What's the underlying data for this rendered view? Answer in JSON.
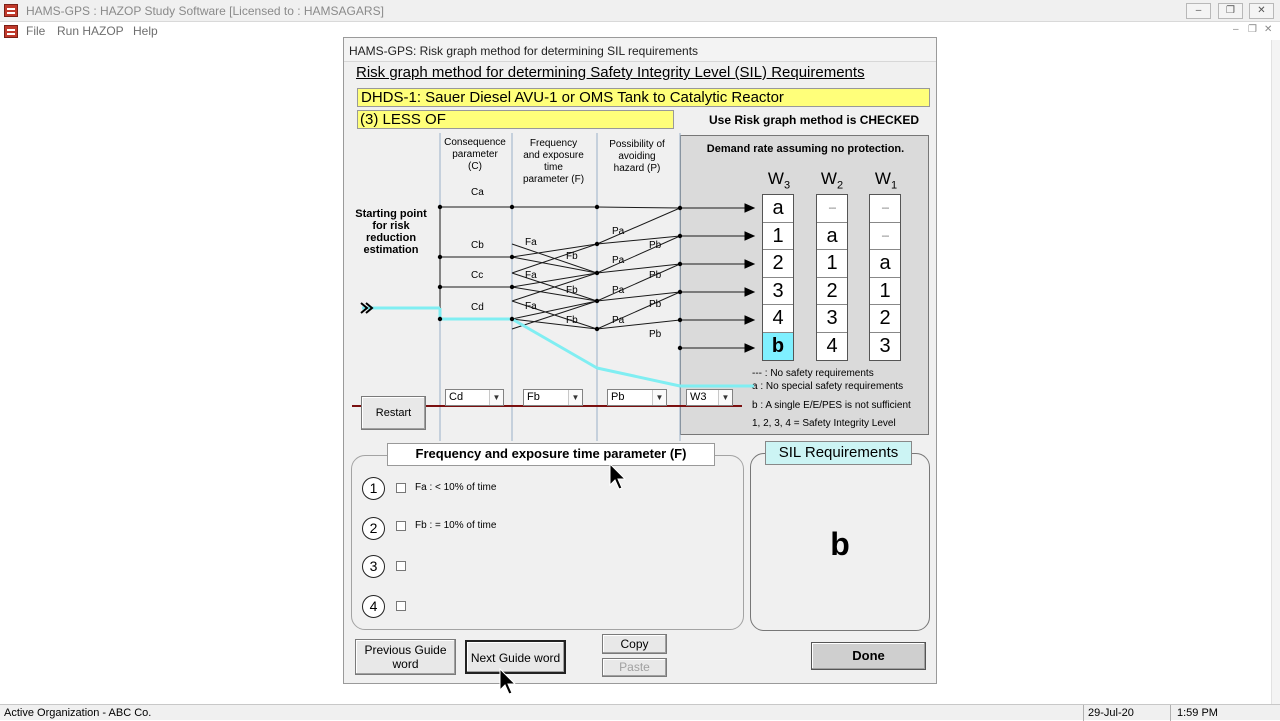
{
  "app": {
    "title": "HAMS-GPS : HAZOP Study Software  [Licensed to : HAMSAGARS]",
    "window_controls": {
      "minimize": "–",
      "restore": "❐",
      "close": "✕"
    },
    "mdi_controls": {
      "minimize": "–",
      "restore": "❐",
      "close": "✕"
    }
  },
  "menu": {
    "items": [
      "File",
      "Run HAZOP",
      "Help"
    ]
  },
  "dialog": {
    "title": "HAMS-GPS: Risk graph method for determining SIL requirements",
    "heading": "Risk graph method for determining Safety Integrity Level (SIL) Requirements",
    "study_node": "DHDS-1: Sauer Diesel AVU-1 or OMS Tank to Catalytic Reactor",
    "guide_word": "(3) LESS OF",
    "method_status": "Use Risk graph method is CHECKED"
  },
  "graph": {
    "start_label": "Starting point for risk reduction estimation",
    "columns": [
      {
        "key": "C",
        "lines": [
          "Consequence",
          "parameter",
          "(C)"
        ]
      },
      {
        "key": "F",
        "lines": [
          "Frequency",
          "and exposure",
          "time",
          "parameter (F)"
        ]
      },
      {
        "key": "P",
        "lines": [
          "Possibility of",
          "avoiding",
          "hazard (P)"
        ]
      }
    ],
    "c_labels": [
      "Ca",
      "Cb",
      "Cc",
      "Cd"
    ],
    "f_labels": [
      "Fa",
      "Fb",
      "Fa",
      "Fb",
      "Fa",
      "Fb"
    ],
    "p_labels": [
      "Pa",
      "Pb",
      "Pa",
      "Pb",
      "Pa",
      "Pb",
      "Pa",
      "Pb"
    ],
    "highlight_color": "#80eef2",
    "line_color": "#1a1a1a"
  },
  "demand": {
    "title": "Demand rate assuming  no protection.",
    "columns": [
      {
        "label": "W",
        "sub": "3",
        "cells": [
          "a",
          "1",
          "2",
          "3",
          "4",
          "b"
        ]
      },
      {
        "label": "W",
        "sub": "2",
        "cells": [
          "---",
          "a",
          "1",
          "2",
          "3",
          "4"
        ]
      },
      {
        "label": "W",
        "sub": "1",
        "cells": [
          "---",
          "---",
          "a",
          "1",
          "2",
          "3"
        ]
      }
    ],
    "highlight_cell": {
      "column": 0,
      "row": 5
    },
    "highlight_color": "#7ff0ff",
    "legend": [
      "--- :  No safety requirements",
      "a : No special safety requirements",
      "b : A single E/E/PES is not sufficient",
      "1, 2, 3, 4 = Safety Integrity Level"
    ]
  },
  "selectors": {
    "consequence": "Cd",
    "frequency": "Fb",
    "possibility": "Pb",
    "demand": "W3"
  },
  "restart_label": "Restart",
  "frequency_group": {
    "title": "Frequency and exposure time parameter (F)",
    "options": [
      {
        "num": "1",
        "label": "Fa : < 10% of time",
        "checked": false
      },
      {
        "num": "2",
        "label": "Fb : = 10% of time",
        "checked": false
      },
      {
        "num": "3",
        "label": "",
        "checked": false
      },
      {
        "num": "4",
        "label": "",
        "checked": false
      }
    ]
  },
  "sil": {
    "title": "SIL Requirements",
    "value": "b"
  },
  "buttons": {
    "previous": "Previous Guide word",
    "next": "Next Guide word",
    "copy": "Copy",
    "paste": "Paste",
    "done": "Done"
  },
  "status": {
    "organization": "Active Organization - ABC Co.",
    "date": "29-Jul-20",
    "time": "1:59 PM"
  },
  "colors": {
    "yellow_field": "#ffff7a",
    "sil_title_bg": "#ccf4f4",
    "separator_line": "#7a1010"
  }
}
